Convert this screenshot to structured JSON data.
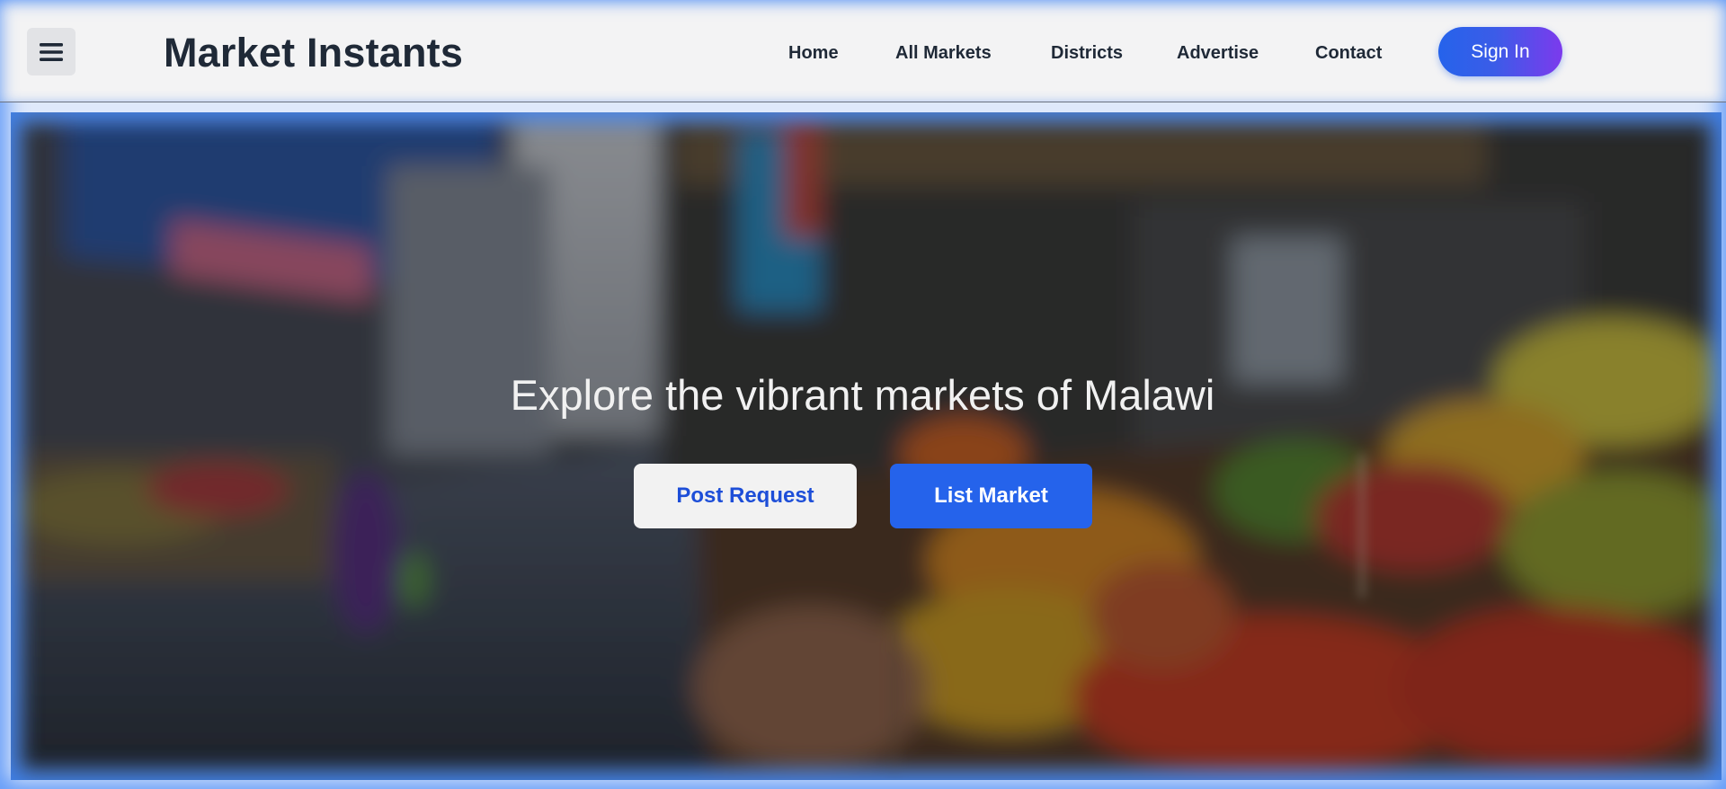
{
  "header": {
    "brand": "Market Instants",
    "menu_icon": "hamburger-menu-icon",
    "nav": [
      {
        "label": "Home"
      },
      {
        "label": "All Markets"
      },
      {
        "label": "Districts"
      },
      {
        "label": "Advertise"
      },
      {
        "label": "Contact"
      }
    ],
    "sign_in_label": "Sign In"
  },
  "hero": {
    "headline": "Explore the vibrant markets of Malawi",
    "primary_button": "Post Request",
    "secondary_button": "List Market"
  },
  "colors": {
    "accent": "#2563eb",
    "gradient_end": "#7c3aed",
    "header_bg": "#f3f3f4",
    "text_dark": "#1f2937"
  }
}
